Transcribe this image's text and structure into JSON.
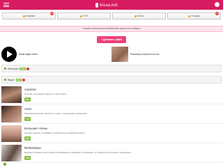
{
  "header": {
    "logo_text": "kissa.net",
    "brand_color": "#d81b60"
  },
  "nav": [
    {
      "label": "Новинки",
      "icon": "star-icon",
      "badge": "13"
    },
    {
      "label": "ТОП",
      "icon": "fire-icon",
      "badge": ""
    },
    {
      "label": "Поиск",
      "icon": "search-icon",
      "badge": ""
    },
    {
      "label": "Отзывы",
      "icon": "comment-icon",
      "badge": "11"
    }
  ],
  "promo": {
    "text": "Скачать бесплатное мобильное порно на телефон"
  },
  "add_video": {
    "label": "+ Добавить файл"
  },
  "features": {
    "left": {
      "text": "Ваше видео сетки"
    },
    "right": {
      "text": "Разовому трахаются поттаи"
    }
  },
  "sections": [
    {
      "label": "Категории",
      "count": "2036"
    },
    {
      "label": "Видео",
      "count": "2036"
    }
  ],
  "categories": [
    {
      "title": "Азиатки",
      "desc": "Горячие утонченные красотки с Азии здесь",
      "count": "540"
    },
    {
      "title": "Анал",
      "desc": "Красивые анальные занятия и порно с отдельными предметами",
      "count": "743"
    },
    {
      "title": "Большие члены",
      "desc": "Крупные пенисы и прибавить поверхностью ромашкой письку",
      "count": "508"
    },
    {
      "title": "Вебкамеры",
      "desc": "Девушки обожают себя снимать на вебкамеры показывая и показывает их твердым естественно ощущением",
      "count": "385"
    },
    {
      "title": "",
      "desc": "",
      "count": ""
    }
  ]
}
